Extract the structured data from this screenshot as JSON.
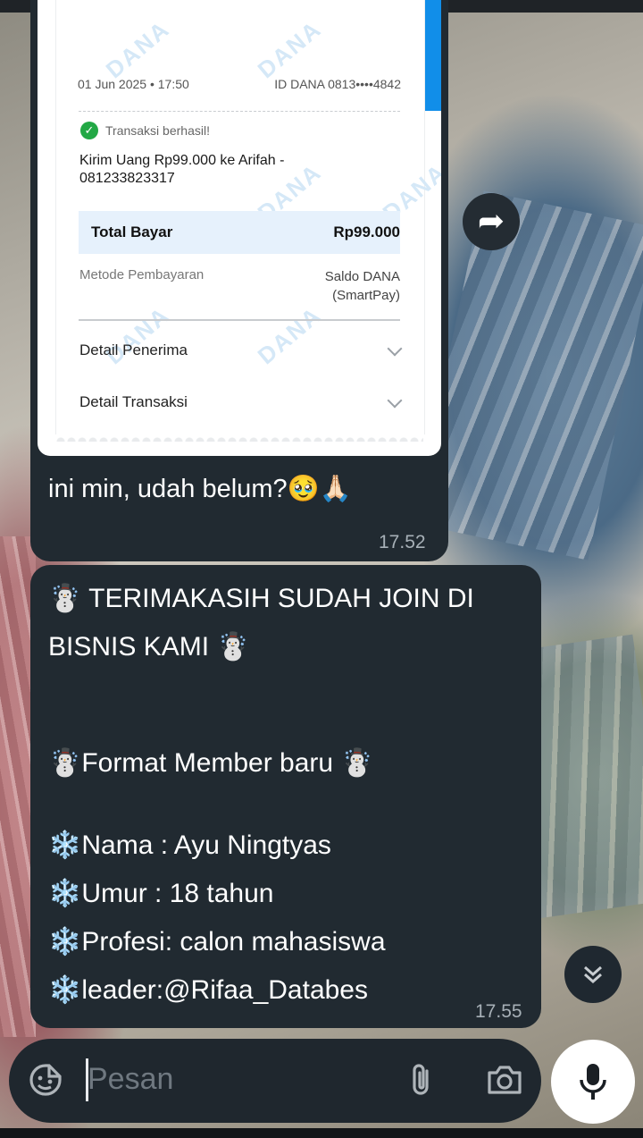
{
  "receipt": {
    "date": "01 Jun 2025 • 17:50",
    "account_id": "ID DANA 0813••••4842",
    "status": "Transaksi berhasil!",
    "description": "Kirim Uang Rp99.000 ke Arifah - 081233823317",
    "total_label": "Total Bayar",
    "total_value": "Rp99.000",
    "method_label": "Metode Pembayaran",
    "method_value_line1": "Saldo DANA",
    "method_value_line2": "(SmartPay)",
    "recipient_detail": "Detail Penerima",
    "transaction_detail": "Detail Transaksi",
    "watermark": "DANA"
  },
  "message1": {
    "text": "ini min, udah belum?🥹🙏🏻",
    "time": "17.52"
  },
  "message2": {
    "lines": [
      "☃️ TERIMAKASIH SUDAH JOIN DI",
      "BISNIS KAMI ☃️",
      "☃️Format Member baru ☃️",
      "❄️Nama : Ayu Ningtyas",
      "❄️Umur : 18 tahun",
      "❄️Profesi: calon mahasiswa",
      "❄️leader:@Rifaa_Databes"
    ],
    "time": "17.55"
  },
  "composer": {
    "placeholder": "Pesan"
  },
  "icons": {
    "forward": "forward-icon",
    "scroll_down": "double-chevron-down-icon",
    "sticker": "sticker-icon",
    "attach": "paperclip-icon",
    "camera": "camera-icon",
    "mic": "microphone-icon",
    "success": "check-circle-icon"
  },
  "colors": {
    "bubble": "#212a31",
    "accent_blue": "#118ee9",
    "success_green": "#22a845"
  }
}
